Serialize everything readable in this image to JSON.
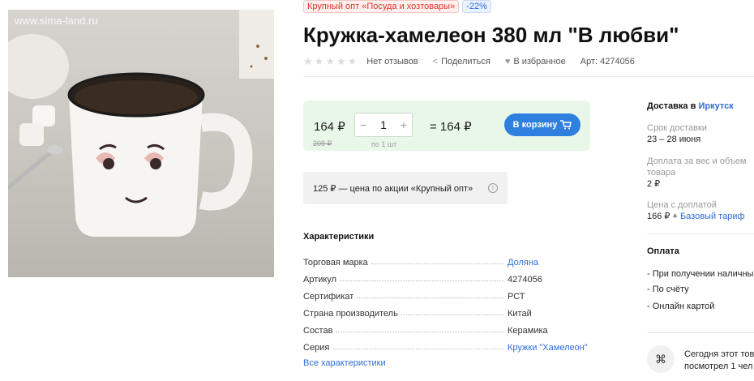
{
  "image": {
    "watermark": "www.sima-land.ru"
  },
  "badges": {
    "promo": "Крупный опт «Посуда и хозтовары»",
    "discount": "-22%"
  },
  "title": "Кружка-хамелеон 380 мл \"В любви\"",
  "meta": {
    "rating_stars": 0,
    "reviews": "Нет отзывов",
    "share": "Поделиться",
    "favorite": "В избранное",
    "article": "Арт: 4274056"
  },
  "price": {
    "current": "164 ₽",
    "old": "209 ₽",
    "quantity": "1",
    "quantity_minus": "−",
    "quantity_plus": "+",
    "per_unit": "по 1 шт",
    "total": "= 164 ₽",
    "cart_button": "В корзину"
  },
  "promo_price": "125 ₽ — цена по акции «Крупный опт»",
  "characteristics": {
    "title": "Характеристики",
    "rows": [
      {
        "key": "Торговая марка",
        "value": "Доляна",
        "link": true
      },
      {
        "key": "Артикул",
        "value": "4274056",
        "link": false
      },
      {
        "key": "Сертификат",
        "value": "РСТ",
        "link": false
      },
      {
        "key": "Страна производитель",
        "value": "Китай",
        "link": false
      },
      {
        "key": "Состав",
        "value": "Керамика",
        "link": false
      },
      {
        "key": "Серия",
        "value": "Кружки \"Хамелеон\"",
        "link": true
      }
    ],
    "all_link": "Все характеристики"
  },
  "delivery": {
    "title": "Доставка в",
    "city": "Иркутск",
    "term_label": "Срок доставки",
    "term_value": "23 – 28 июня",
    "surcharge_label_1": "Доплата за вес и объем",
    "surcharge_label_2": "товара",
    "surcharge_value": "2 ₽",
    "price_with_label": "Цена с доплатой",
    "price_with_value": "166 ₽ + ",
    "tariff_link": "Базовый тариф"
  },
  "payment": {
    "title": "Оплата",
    "items": [
      "- При получении наличны",
      "- По счёту",
      "- Онлайн картой"
    ]
  },
  "today": {
    "line1": "Сегодня этот тов",
    "line2": "посмотрел 1 чел"
  },
  "colors": {
    "accent": "#2f7fe0",
    "promo_red": "#e0352b",
    "price_bg": "#e9f7e9"
  }
}
